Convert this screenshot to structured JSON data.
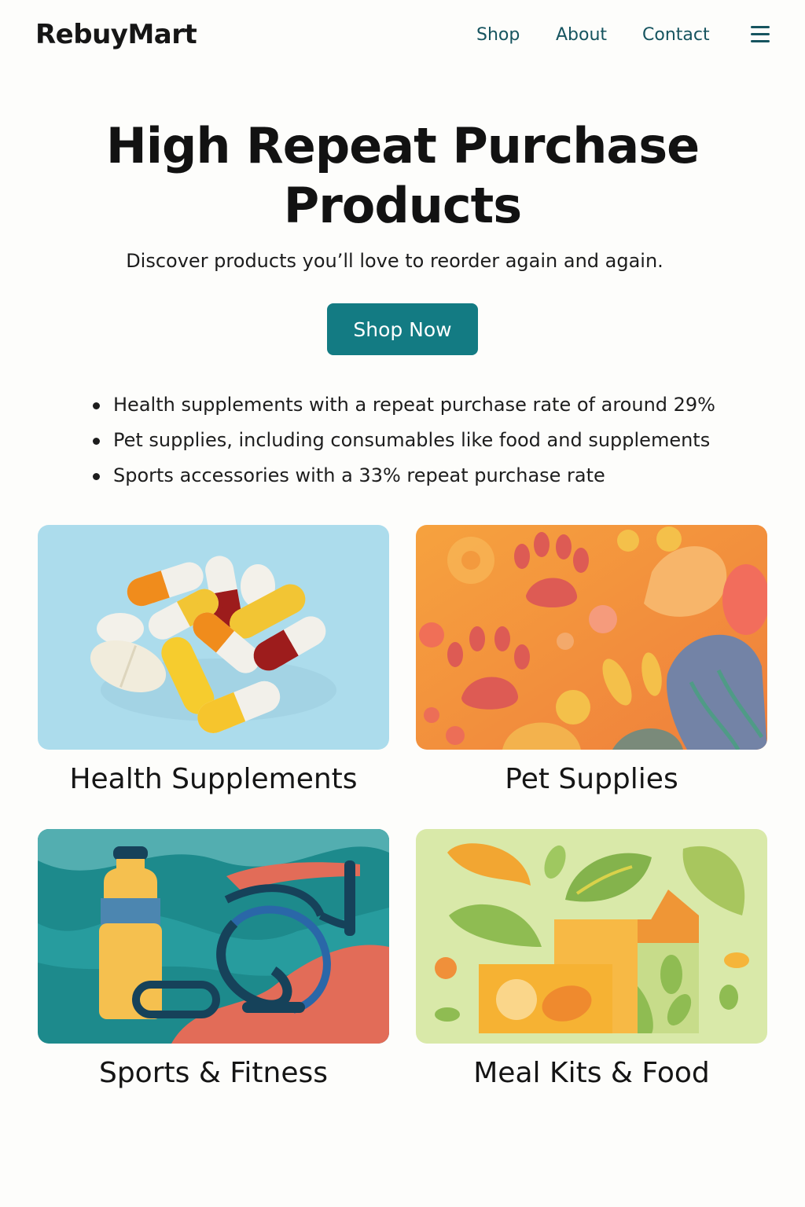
{
  "brand": "RebuyMart",
  "nav": {
    "links": [
      "Shop",
      "About",
      "Contact"
    ],
    "menu_icon": "hamburger-menu-icon"
  },
  "hero": {
    "title": "High Repeat Purchase Products",
    "subtitle": "Discover products you’ll love to reorder again and again.",
    "cta_label": "Shop Now"
  },
  "highlights": [
    "Health supplements with a repeat purchase rate of around 29%",
    "Pet supplies, including consumables like food and supplements",
    "Sports accessories with a 33% repeat purchase rate"
  ],
  "categories": [
    {
      "label": "Health Supplements",
      "image": "capsules-illustration"
    },
    {
      "label": "Pet Supplies",
      "image": "paw-prints-illustration"
    },
    {
      "label": "Sports & Fitness",
      "image": "water-bottle-resistance-band-illustration"
    },
    {
      "label": "Meal Kits & Food",
      "image": "food-boxes-leaves-illustration"
    }
  ],
  "colors": {
    "accent": "#137b83",
    "nav_link": "#16545f",
    "text": "#141414"
  }
}
